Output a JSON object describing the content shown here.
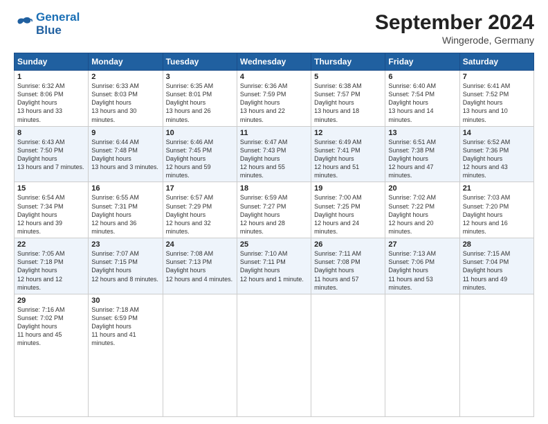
{
  "header": {
    "logo_line1": "General",
    "logo_line2": "Blue",
    "month": "September 2024",
    "location": "Wingerode, Germany"
  },
  "weekdays": [
    "Sunday",
    "Monday",
    "Tuesday",
    "Wednesday",
    "Thursday",
    "Friday",
    "Saturday"
  ],
  "weeks": [
    [
      {
        "day": "1",
        "sunrise": "6:32 AM",
        "sunset": "8:06 PM",
        "daylight": "13 hours and 33 minutes."
      },
      {
        "day": "2",
        "sunrise": "6:33 AM",
        "sunset": "8:03 PM",
        "daylight": "13 hours and 30 minutes."
      },
      {
        "day": "3",
        "sunrise": "6:35 AM",
        "sunset": "8:01 PM",
        "daylight": "13 hours and 26 minutes."
      },
      {
        "day": "4",
        "sunrise": "6:36 AM",
        "sunset": "7:59 PM",
        "daylight": "13 hours and 22 minutes."
      },
      {
        "day": "5",
        "sunrise": "6:38 AM",
        "sunset": "7:57 PM",
        "daylight": "13 hours and 18 minutes."
      },
      {
        "day": "6",
        "sunrise": "6:40 AM",
        "sunset": "7:54 PM",
        "daylight": "13 hours and 14 minutes."
      },
      {
        "day": "7",
        "sunrise": "6:41 AM",
        "sunset": "7:52 PM",
        "daylight": "13 hours and 10 minutes."
      }
    ],
    [
      {
        "day": "8",
        "sunrise": "6:43 AM",
        "sunset": "7:50 PM",
        "daylight": "13 hours and 7 minutes."
      },
      {
        "day": "9",
        "sunrise": "6:44 AM",
        "sunset": "7:48 PM",
        "daylight": "13 hours and 3 minutes."
      },
      {
        "day": "10",
        "sunrise": "6:46 AM",
        "sunset": "7:45 PM",
        "daylight": "12 hours and 59 minutes."
      },
      {
        "day": "11",
        "sunrise": "6:47 AM",
        "sunset": "7:43 PM",
        "daylight": "12 hours and 55 minutes."
      },
      {
        "day": "12",
        "sunrise": "6:49 AM",
        "sunset": "7:41 PM",
        "daylight": "12 hours and 51 minutes."
      },
      {
        "day": "13",
        "sunrise": "6:51 AM",
        "sunset": "7:38 PM",
        "daylight": "12 hours and 47 minutes."
      },
      {
        "day": "14",
        "sunrise": "6:52 AM",
        "sunset": "7:36 PM",
        "daylight": "12 hours and 43 minutes."
      }
    ],
    [
      {
        "day": "15",
        "sunrise": "6:54 AM",
        "sunset": "7:34 PM",
        "daylight": "12 hours and 39 minutes."
      },
      {
        "day": "16",
        "sunrise": "6:55 AM",
        "sunset": "7:31 PM",
        "daylight": "12 hours and 36 minutes."
      },
      {
        "day": "17",
        "sunrise": "6:57 AM",
        "sunset": "7:29 PM",
        "daylight": "12 hours and 32 minutes."
      },
      {
        "day": "18",
        "sunrise": "6:59 AM",
        "sunset": "7:27 PM",
        "daylight": "12 hours and 28 minutes."
      },
      {
        "day": "19",
        "sunrise": "7:00 AM",
        "sunset": "7:25 PM",
        "daylight": "12 hours and 24 minutes."
      },
      {
        "day": "20",
        "sunrise": "7:02 AM",
        "sunset": "7:22 PM",
        "daylight": "12 hours and 20 minutes."
      },
      {
        "day": "21",
        "sunrise": "7:03 AM",
        "sunset": "7:20 PM",
        "daylight": "12 hours and 16 minutes."
      }
    ],
    [
      {
        "day": "22",
        "sunrise": "7:05 AM",
        "sunset": "7:18 PM",
        "daylight": "12 hours and 12 minutes."
      },
      {
        "day": "23",
        "sunrise": "7:07 AM",
        "sunset": "7:15 PM",
        "daylight": "12 hours and 8 minutes."
      },
      {
        "day": "24",
        "sunrise": "7:08 AM",
        "sunset": "7:13 PM",
        "daylight": "12 hours and 4 minutes."
      },
      {
        "day": "25",
        "sunrise": "7:10 AM",
        "sunset": "7:11 PM",
        "daylight": "12 hours and 1 minute."
      },
      {
        "day": "26",
        "sunrise": "7:11 AM",
        "sunset": "7:08 PM",
        "daylight": "11 hours and 57 minutes."
      },
      {
        "day": "27",
        "sunrise": "7:13 AM",
        "sunset": "7:06 PM",
        "daylight": "11 hours and 53 minutes."
      },
      {
        "day": "28",
        "sunrise": "7:15 AM",
        "sunset": "7:04 PM",
        "daylight": "11 hours and 49 minutes."
      }
    ],
    [
      {
        "day": "29",
        "sunrise": "7:16 AM",
        "sunset": "7:02 PM",
        "daylight": "11 hours and 45 minutes."
      },
      {
        "day": "30",
        "sunrise": "7:18 AM",
        "sunset": "6:59 PM",
        "daylight": "11 hours and 41 minutes."
      },
      null,
      null,
      null,
      null,
      null
    ]
  ]
}
